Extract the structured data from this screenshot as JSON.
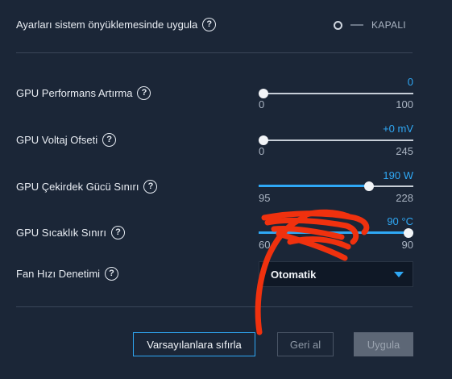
{
  "preview": {
    "label": "Ayarları sistem önyüklemesinde uygula",
    "help": "?",
    "toggle_state": "KAPALI"
  },
  "sliders": [
    {
      "label": "GPU Performans Artırma",
      "help": "?",
      "value_text": "0",
      "min": "0",
      "max": "100",
      "fraction": 0.0
    },
    {
      "label": "GPU Voltaj Ofseti",
      "help": "?",
      "value_text": "+0 mV",
      "min": "0",
      "max": "245",
      "fraction": 0.0
    },
    {
      "label": "GPU Çekirdek Gücü Sınırı",
      "help": "?",
      "value_text": "190 W",
      "min": "95",
      "max": "228",
      "fraction": 0.714
    },
    {
      "label": "GPU Sıcaklık Sınırı",
      "help": "?",
      "value_text": "90 °C",
      "min": "60",
      "max": "90",
      "fraction": 1.0
    }
  ],
  "fan": {
    "label": "Fan Hızı Denetimi",
    "help": "?",
    "selected": "Otomatik"
  },
  "buttons": {
    "reset": "Varsayılanlara sıfırla",
    "undo": "Geri al",
    "apply": "Uygula"
  },
  "colors": {
    "accent": "#2fa8f5",
    "background": "#1b2637",
    "annotation": "#f0310e"
  }
}
